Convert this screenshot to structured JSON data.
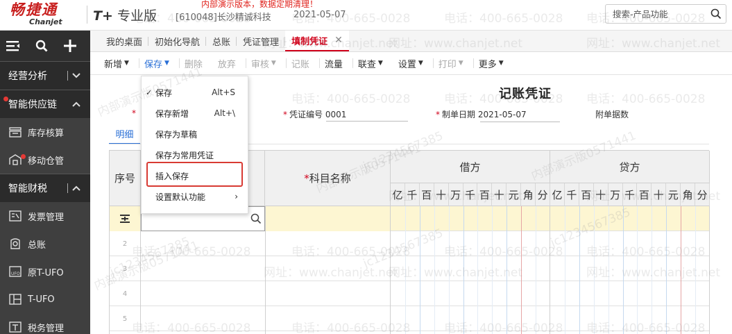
{
  "header": {
    "logo_cn": "畅捷通",
    "logo_en": "Chanjet",
    "product_prefix": "T+",
    "product_name": "专业版",
    "company": "[610048]长沙精诚科技",
    "date": "2021-05-07",
    "notice": "内部演示版本，数据定期清理！",
    "search_placeholder": "搜索-产品功能"
  },
  "sidebar": {
    "tools": [
      "menu-icon",
      "search-icon",
      "plus-icon"
    ],
    "groups": [
      {
        "label": "经营分析",
        "arrow": "chevron-down"
      },
      {
        "label": "智能供应链",
        "arrow": "chevron-up"
      }
    ],
    "supply_items": [
      {
        "label": "库存核算",
        "icon": "inventory-icon"
      },
      {
        "label": "移动仓管",
        "icon": "mobile-warehouse-icon"
      }
    ],
    "finance_group": {
      "label": "智能财税",
      "arrow": "chevron-up"
    },
    "finance_items": [
      {
        "label": "发票管理",
        "icon": "invoice-icon"
      },
      {
        "label": "总账",
        "icon": "ledger-icon"
      },
      {
        "label": "原T-UFO",
        "icon": "ufo-icon"
      },
      {
        "label": "T-UFO",
        "icon": "tufo-icon"
      },
      {
        "label": "税务管理",
        "icon": "tax-icon"
      }
    ]
  },
  "tabs": [
    "我的桌面",
    "初始化导航",
    "总账",
    "凭证管理"
  ],
  "active_tab": "填制凭证",
  "toolbar": {
    "new": "新增",
    "save": "保存",
    "delete": "删除",
    "discard": "放弃",
    "audit": "审核",
    "post": "记账",
    "flow": "流量",
    "query": "联查",
    "settings": "设置",
    "print": "打印",
    "more": "更多"
  },
  "save_menu": {
    "items": [
      {
        "label": "保存",
        "shortcut": "Alt+S",
        "checked": true
      },
      {
        "label": "保存新增",
        "shortcut": "Alt+\\"
      },
      {
        "label": "保存为草稿"
      },
      {
        "label": "保存为常用凭证"
      },
      {
        "label": "插入保存",
        "highlighted": true
      },
      {
        "label": "设置默认功能",
        "submenu": true
      }
    ]
  },
  "voucher": {
    "title": "记账凭证",
    "voucher_no_label": "凭证编号",
    "voucher_no": "0001",
    "date_label": "制单日期",
    "date": "2021-05-07",
    "attachments_label": "附单据数",
    "detail_tab": "明细"
  },
  "grid": {
    "col_seq": "序号",
    "col_account": "科目名称",
    "col_debit": "借方",
    "col_credit": "贷方",
    "digits": [
      "亿",
      "千",
      "百",
      "十",
      "万",
      "千",
      "百",
      "十",
      "元",
      "角",
      "分"
    ],
    "rows": [
      "",
      "2",
      "3",
      "4",
      "5"
    ]
  },
  "watermark": {
    "phone": "电话：400-665-0028",
    "site": "网址：www.chanjet.net",
    "demo": "内部演示版0571441",
    "code": "jc1234567385"
  },
  "colors": {
    "brand_red": "#c8201f",
    "active_tab": "#d0021b",
    "link_blue": "#2a6fd6",
    "sidebar_bg": "#3f3f3f",
    "highlight_box": "#d83a33",
    "current_row": "#fdf6d2"
  }
}
